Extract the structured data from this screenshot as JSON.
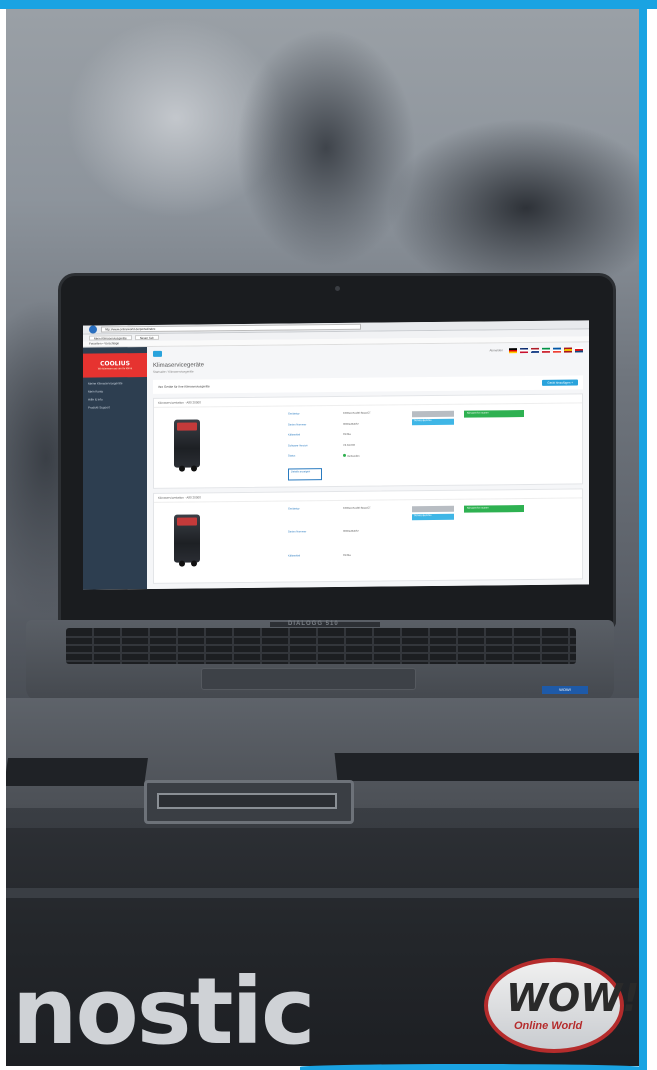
{
  "colors": {
    "frame_accent": "#1aa3e2",
    "app_sidebar": "#2d3e50",
    "app_logo_bg": "#e63330",
    "app_primary": "#29a3dc",
    "app_success": "#2eb151"
  },
  "laptop_screen": {
    "browser": {
      "url": "http://www.onlineworld.de/portal/index",
      "tab_1": "Mein Klimaservicegeräte",
      "tab_2": "Neuer Tab",
      "favorites": "Favoriten • Vorschläge"
    },
    "app": {
      "logo": "COOLIUS",
      "logo_sub": "Wir kümmern uns um Ihr Klima",
      "sidebar_items": [
        "Meine Klimaservicegeräte",
        "Mein Konto",
        "Hilfe & Info",
        "Produkt-Support"
      ],
      "logout": "Abmelden",
      "flags": [
        {
          "name": "de-flag",
          "colors": [
            "#000000",
            "#dd0000",
            "#ffce00"
          ]
        },
        {
          "name": "uk-flag",
          "colors": [
            "#012169",
            "#ffffff",
            "#c8102e"
          ]
        },
        {
          "name": "nl-flag",
          "colors": [
            "#ae1c28",
            "#ffffff",
            "#21468b"
          ]
        },
        {
          "name": "it-flag",
          "colors": [
            "#009246",
            "#ffffff",
            "#ce2b37"
          ]
        },
        {
          "name": "fr-flag",
          "colors": [
            "#0055a4",
            "#ffffff",
            "#ef4135"
          ]
        },
        {
          "name": "es-flag",
          "colors": [
            "#aa151b",
            "#f1bf00",
            "#aa151b"
          ]
        },
        {
          "name": "cz-flag",
          "colors": [
            "#ffffff",
            "#d7141a",
            "#11457e"
          ]
        }
      ],
      "page_title": "Klimaservicegeräte",
      "breadcrumb": "Startseite  /  Klimaservicegeräte",
      "info_text": "Ihre Geräte für Ihre Klimaservicegeräte",
      "add_button": "Gerät hinzufügen +",
      "cards": [
        {
          "header": "Klimaservicestation · A80 20000",
          "props": [
            {
              "k": "Gerätetyp",
              "v": "COOLIUS A80 SELECT"
            },
            {
              "k": "Serien-Nummer",
              "v": "00001234567"
            },
            {
              "k": "Kältemittel",
              "v": "R134a"
            },
            {
              "k": "Software-Version",
              "v": "V2.04.003"
            },
            {
              "k": "Status",
              "v": "Verbunden"
            }
          ],
          "details_button": "Details anzeigen",
          "cyan_button": "Service-Berichte",
          "green_button": "Klimaservice starten"
        },
        {
          "header": "Klimaservicestation · A80 20000",
          "props": [
            {
              "k": "Gerätetyp",
              "v": "COOLIUS A80 SELECT"
            },
            {
              "k": "Serien-Nummer",
              "v": "00001234567"
            },
            {
              "k": "Kältemittel",
              "v": "R134a"
            }
          ],
          "cyan_button": "Service-Berichte",
          "green_button": "Klimaservice starten"
        }
      ]
    }
  },
  "laptop_brand": "DIALOGG 510",
  "laptop_sticker": "WOW!",
  "cart_text": "nostic",
  "badge": {
    "main": "WOW!",
    "sub": "Online World"
  }
}
